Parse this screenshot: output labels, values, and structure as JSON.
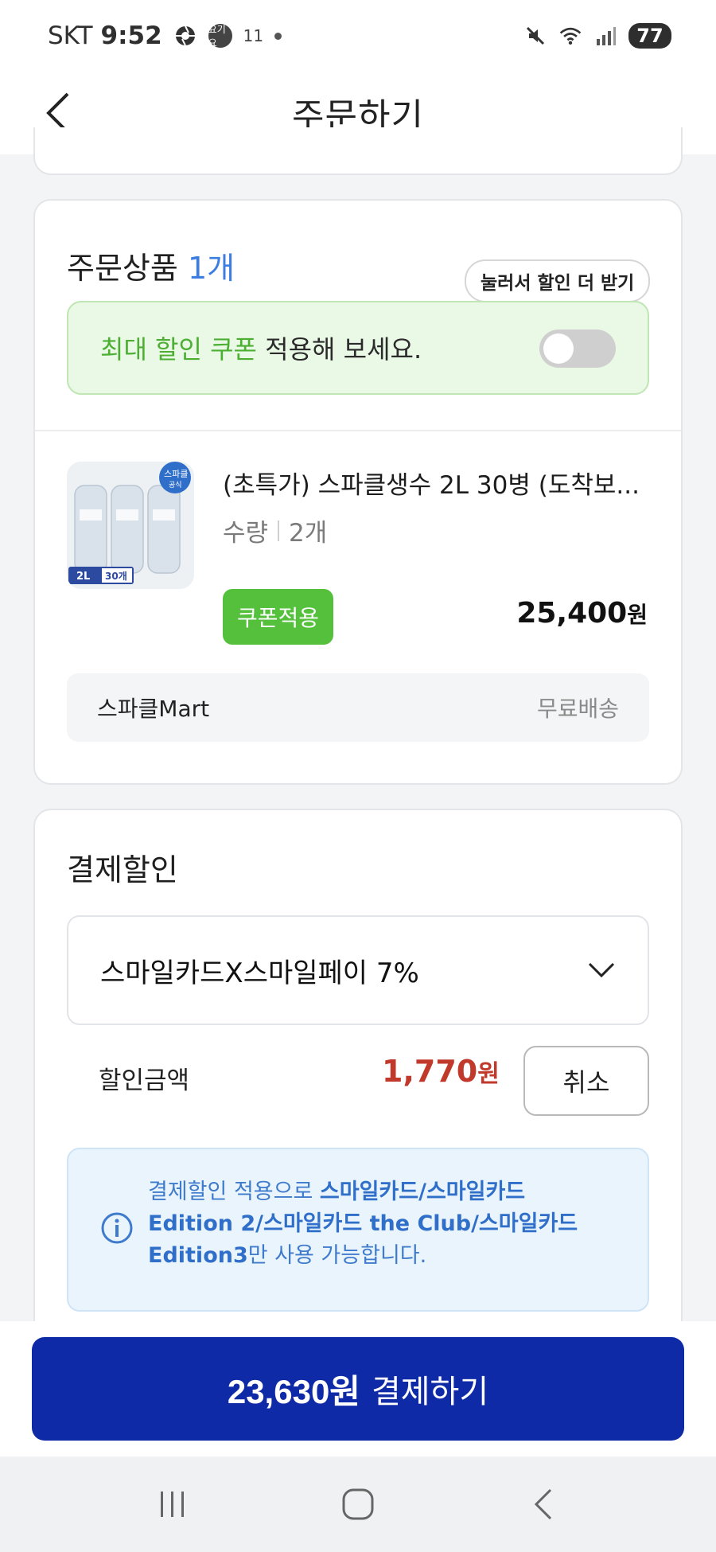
{
  "status_bar": {
    "carrier": "SKT",
    "time": "9:52",
    "chip_label": "요기요",
    "small_label": "11",
    "battery": "77",
    "icons": [
      "camera-shutter-icon",
      "app-badge-icon",
      "mute-icon",
      "wifi-icon",
      "signal-icon"
    ]
  },
  "app_bar": {
    "title": "주문하기",
    "back_icon": "chevron-left-icon"
  },
  "order_section": {
    "title": "주문상품",
    "count": "1개",
    "tooltip": "눌러서 할인 더 받기",
    "coupon_banner": {
      "highlight": "최대 할인 쿠폰",
      "rest": " 적용해 보세요.",
      "toggle_on": false
    },
    "product": {
      "name": "(초특가) 스파클생수 2L 30병 (도착보...",
      "qty_label": "수량",
      "qty_value": "2개",
      "coupon_button": "쿠폰적용",
      "price_number": "25,400",
      "price_unit": "원",
      "image_badges": {
        "brand": "스파클",
        "brand_sub": "공식",
        "size": "2L",
        "count": "30개"
      }
    },
    "seller": {
      "name": "스파클Mart",
      "shipping": "무료배송"
    }
  },
  "payment_discount": {
    "title": "결제할인",
    "selected_option": "스마일카드X스마일페이 7%",
    "discount_label": "할인금액",
    "discount_number": "1,770",
    "discount_unit": "원",
    "cancel_button": "취소",
    "info": {
      "prefix": "결제할인 적용으로 ",
      "bold": "스마일카드/스마일카드 Edition 2/스마일카드 the Club/스마일카드 Edition3",
      "suffix": "만 사용 가능합니다."
    }
  },
  "pay_button": {
    "amount": "23,630원",
    "action": "결제하기"
  },
  "colors": {
    "accent_blue": "#0f2aa6",
    "coupon_green": "#55c03c",
    "discount_red": "#c0392b",
    "count_blue": "#3b7de0"
  },
  "nav_bar": {
    "icons": [
      "recent-apps-icon",
      "home-icon",
      "back-icon"
    ]
  }
}
